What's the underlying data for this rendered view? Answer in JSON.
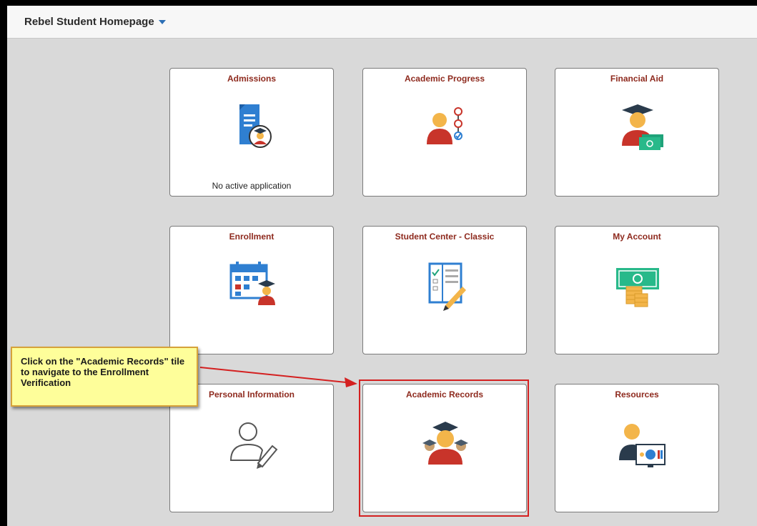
{
  "header": {
    "title": "Rebel Student Homepage",
    "dropdown_icon": "caret-down-icon"
  },
  "tiles": [
    {
      "title": "Admissions",
      "subtitle": "No active application",
      "icon": "document-student-icon"
    },
    {
      "title": "Academic Progress",
      "icon": "student-progress-icon"
    },
    {
      "title": "Financial Aid",
      "icon": "graduate-money-icon"
    },
    {
      "title": "Enrollment",
      "icon": "calendar-student-icon"
    },
    {
      "title": "Student Center - Classic",
      "icon": "checklist-pencil-icon"
    },
    {
      "title": "My Account",
      "icon": "cash-coins-icon"
    },
    {
      "title": "Personal Information",
      "icon": "user-edit-icon"
    },
    {
      "title": "Academic Records",
      "icon": "graduates-icon"
    },
    {
      "title": "Resources",
      "icon": "person-monitor-icon"
    }
  ],
  "callout": {
    "text": "Click on the \"Academic Records\" tile to navigate to the Enrollment Verification"
  },
  "colors": {
    "tile_title": "#8e2a1e",
    "highlight": "#d42020",
    "callout_bg": "#fefe9a"
  }
}
